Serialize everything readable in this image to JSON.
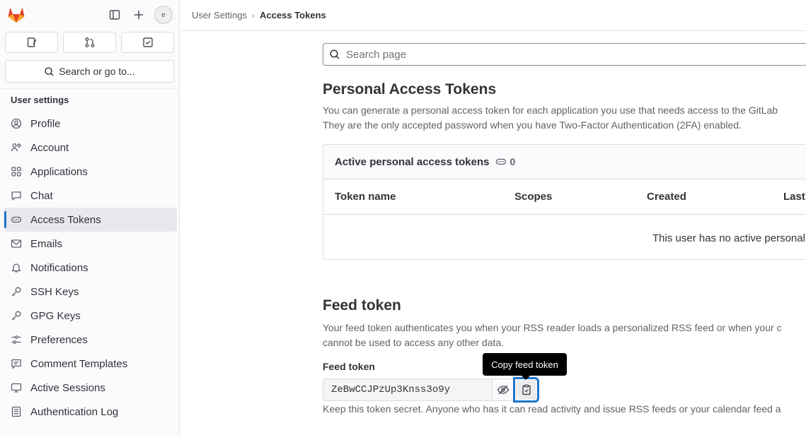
{
  "sidebar": {
    "avatar_alt": "e",
    "search_label": "Search or go to...",
    "section_title": "User settings",
    "items": [
      {
        "label": "Profile",
        "icon": "profile-icon"
      },
      {
        "label": "Account",
        "icon": "account-icon"
      },
      {
        "label": "Applications",
        "icon": "applications-icon"
      },
      {
        "label": "Chat",
        "icon": "chat-icon"
      },
      {
        "label": "Access Tokens",
        "icon": "token-icon",
        "active": true
      },
      {
        "label": "Emails",
        "icon": "mail-icon"
      },
      {
        "label": "Notifications",
        "icon": "bell-icon"
      },
      {
        "label": "SSH Keys",
        "icon": "key-icon"
      },
      {
        "label": "GPG Keys",
        "icon": "key-icon"
      },
      {
        "label": "Preferences",
        "icon": "preferences-icon"
      },
      {
        "label": "Comment Templates",
        "icon": "comment-icon"
      },
      {
        "label": "Active Sessions",
        "icon": "monitor-icon"
      },
      {
        "label": "Authentication Log",
        "icon": "log-icon"
      }
    ]
  },
  "header": {
    "breadcrumb_parent": "User Settings",
    "breadcrumb_separator": "›",
    "breadcrumb_current": "Access Tokens"
  },
  "main": {
    "search_placeholder": "Search page",
    "pat": {
      "title": "Personal Access Tokens",
      "desc_line1": "You can generate a personal access token for each application you use that needs access to the GitLab",
      "desc_line2": "They are the only accepted password when you have Two-Factor Authentication (2FA) enabled.",
      "card_title": "Active personal access tokens",
      "card_count": "0",
      "columns": [
        "Token name",
        "Scopes",
        "Created",
        "Last"
      ],
      "empty_text": "This user has no active personal"
    },
    "feed": {
      "title": "Feed token",
      "desc_line1": "Your feed token authenticates you when your RSS reader loads a personalized RSS feed or when your c",
      "desc_line2": "cannot be used to access any other data.",
      "label": "Feed token",
      "value": "ZeBwCCJPzUp3Knss3o9y",
      "tooltip": "Copy feed token",
      "help": "Keep this token secret. Anyone who has it can read activity and issue RSS feeds or your calendar feed a"
    }
  },
  "colors": {
    "accent": "#1f75cb",
    "logo_orange": "#fc6d26",
    "logo_red": "#e24329",
    "logo_yellow": "#fca326"
  }
}
